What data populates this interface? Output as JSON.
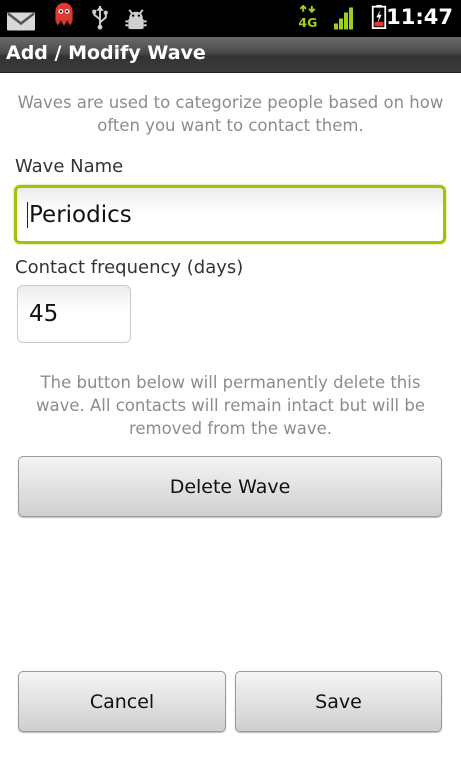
{
  "status_bar": {
    "time": "11:47",
    "network_type": "4G",
    "icons": [
      "gmail-icon",
      "notification-icon",
      "usb-icon",
      "android-debug-icon",
      "network-4g-icon",
      "signal-icon",
      "battery-charging-icon"
    ]
  },
  "title_bar": {
    "title": "Add / Modify Wave"
  },
  "form": {
    "intro_text": "Waves are used to categorize people based on how often you want to contact them.",
    "wave_name_label": "Wave Name",
    "wave_name_value": "Periodics",
    "frequency_label": "Contact frequency (days)",
    "frequency_value": "45",
    "delete_warning": "The button below will permanently delete this wave.  All contacts will remain intact but will be removed from the wave.",
    "delete_button": "Delete Wave"
  },
  "actions": {
    "cancel": "Cancel",
    "save": "Save"
  },
  "colors": {
    "focus_border": "#9cc30f",
    "helper_text": "#8c8c8c",
    "status_icon_green": "#9ecf1e",
    "notification_red": "#e0392f"
  }
}
